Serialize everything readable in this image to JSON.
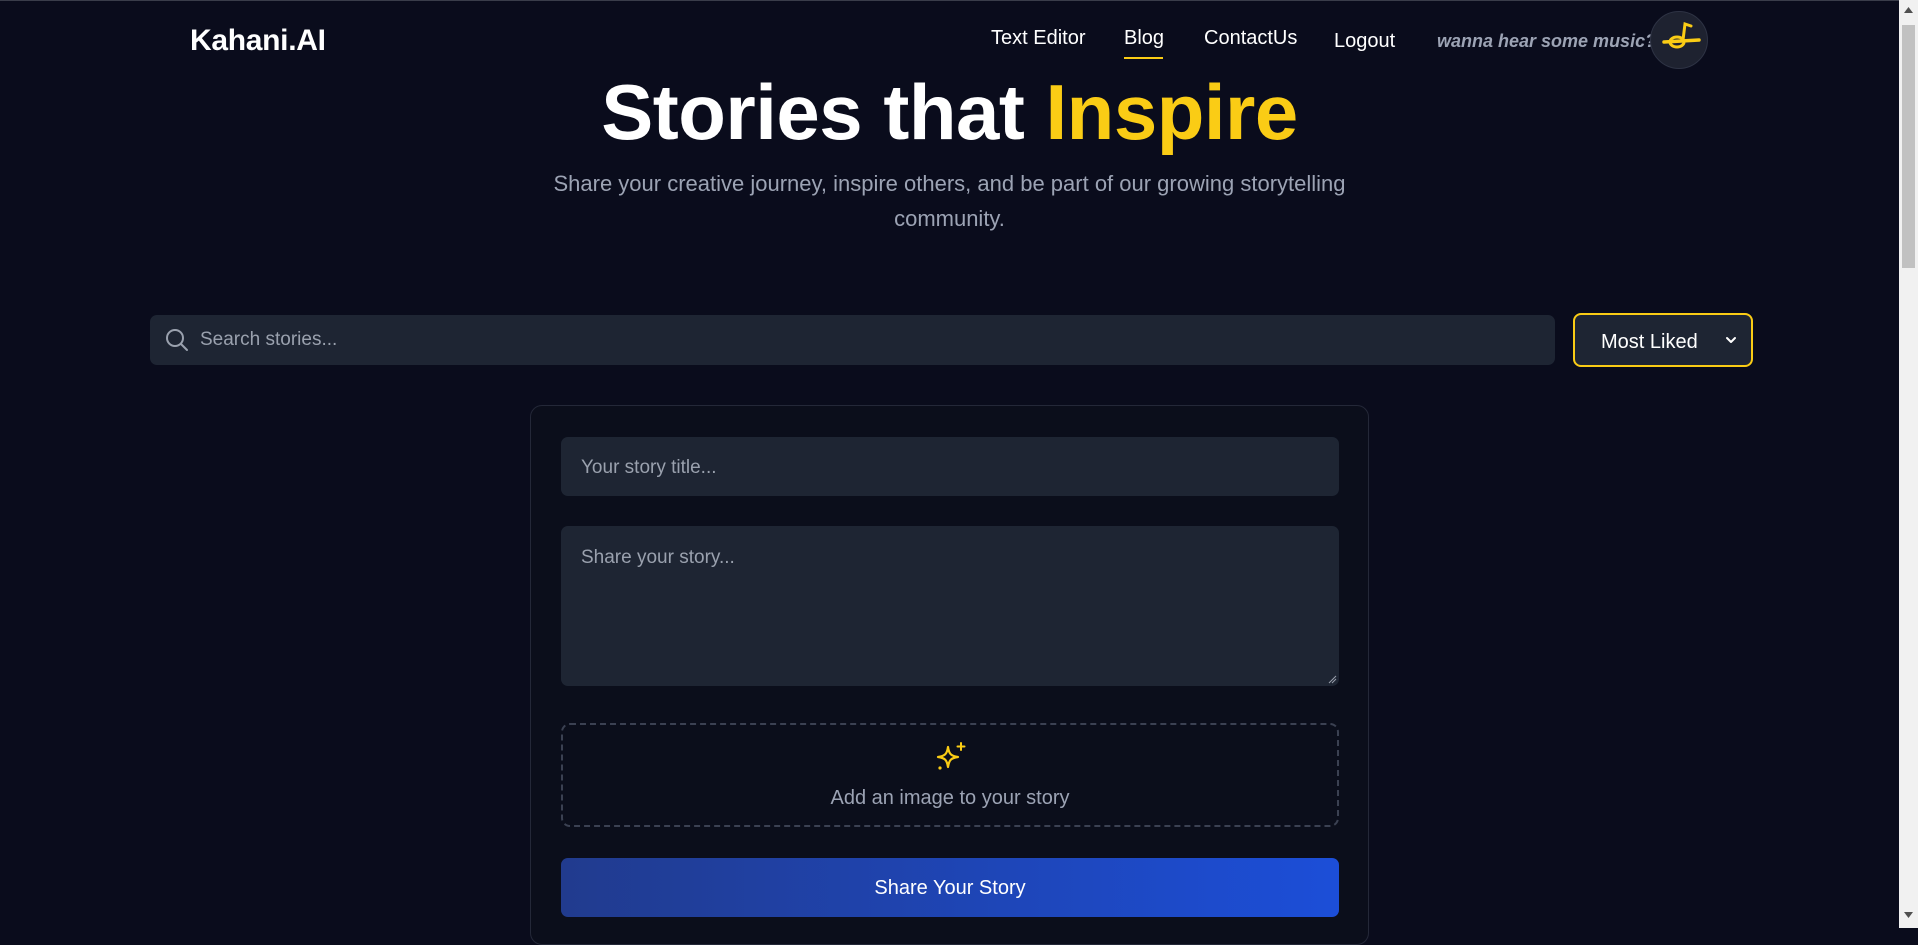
{
  "header": {
    "logo": "Kahani.AI",
    "nav": [
      {
        "label": "Text Editor",
        "active": false
      },
      {
        "label": "Blog",
        "active": true
      },
      {
        "label": "ContactUs",
        "active": false
      },
      {
        "label": "Logout",
        "active": false
      }
    ],
    "music_prompt": "wanna hear some music?",
    "music_button_icon": "music-off-icon"
  },
  "hero": {
    "title_main": "Stories that ",
    "title_accent": "Inspire",
    "subtitle": "Share your creative journey, inspire others, and be part of our growing storytelling community."
  },
  "search": {
    "placeholder": "Search stories...",
    "icon": "search-icon"
  },
  "sort": {
    "selected": "Most Liked",
    "icon": "chevron-down-icon"
  },
  "form": {
    "title_placeholder": "Your story title...",
    "story_placeholder": "Share your story...",
    "image_label": "Add an image to your story",
    "image_icon": "sparkles-icon",
    "submit_label": "Share Your Story"
  },
  "colors": {
    "background": "#0a0c1c",
    "accent": "#facc15",
    "input_bg": "#1e2533",
    "button_gradient_start": "#213b8e",
    "button_gradient_end": "#1c4ed8",
    "muted_text": "#9ca3b4"
  }
}
